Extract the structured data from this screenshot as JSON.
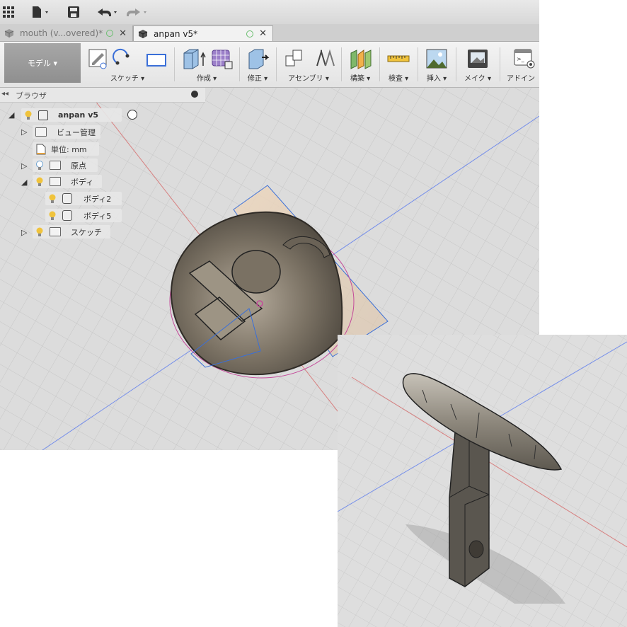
{
  "tabs": [
    {
      "label": "mouth (v...overed)*"
    },
    {
      "label": "anpan v5*"
    }
  ],
  "toolbar": {
    "mode_label": "モデル ▾",
    "groups": [
      {
        "label": "スケッチ ▾"
      },
      {
        "label": "作成 ▾"
      },
      {
        "label": "修正 ▾"
      },
      {
        "label": "アセンブリ ▾"
      },
      {
        "label": "構築 ▾"
      },
      {
        "label": "検査 ▾"
      },
      {
        "label": "挿入 ▾"
      },
      {
        "label": "メイク ▾"
      },
      {
        "label": "アドイン"
      }
    ]
  },
  "browser": {
    "title": "ブラウザ",
    "root": "anpan v5",
    "items": [
      {
        "label": "ビュー管理"
      },
      {
        "label": "単位: mm"
      },
      {
        "label": "原点"
      },
      {
        "label": "ボディ"
      },
      {
        "label": "ボディ2"
      },
      {
        "label": "ボディ5"
      },
      {
        "label": "スケッチ"
      }
    ]
  },
  "colors": {
    "bulb": "#f0c33c",
    "body_metal": "#6e675c",
    "sketch_line": "#3a6fd8",
    "axis_red": "#d44444",
    "axis_blue": "#4a6ef0"
  }
}
